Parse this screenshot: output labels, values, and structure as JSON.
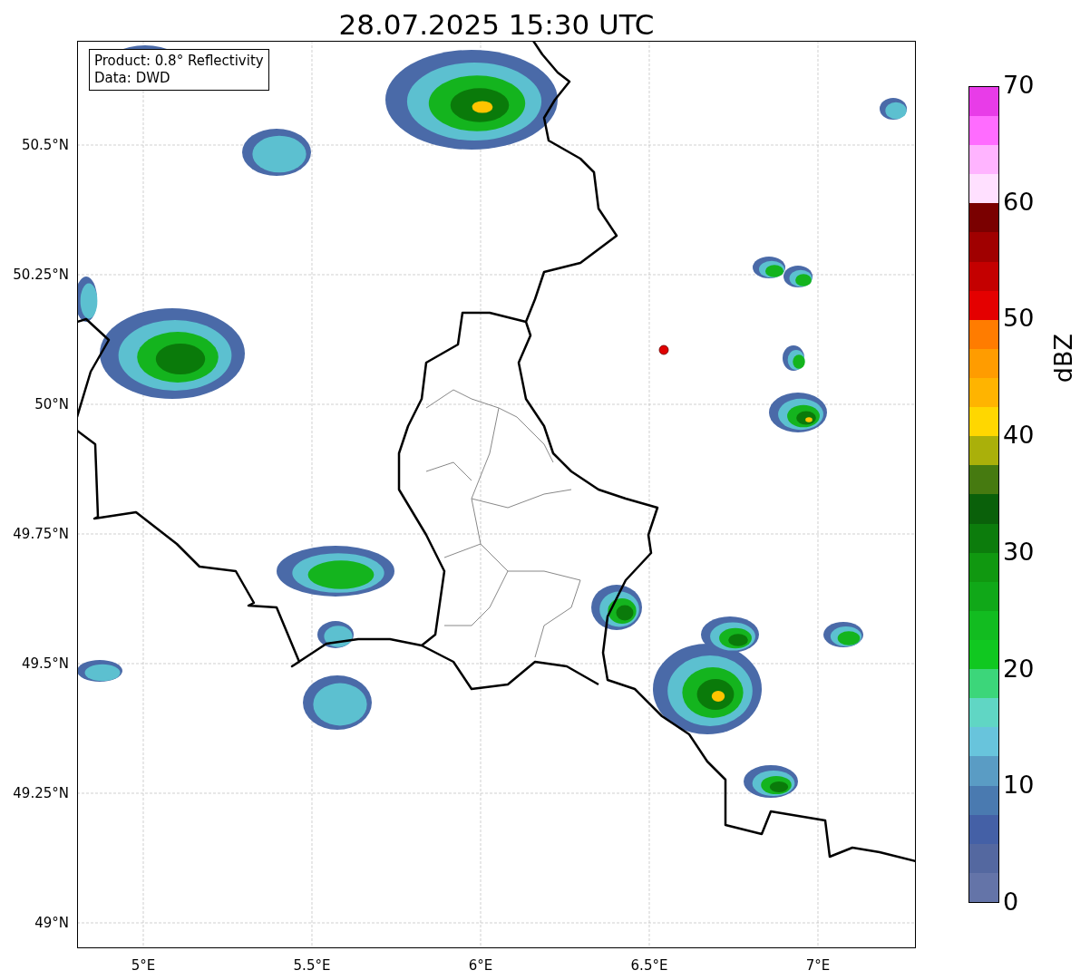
{
  "title": "28.07.2025 15:30 UTC",
  "legend": [
    "Product: 0.8° Reflectivity",
    "Data: DWD"
  ],
  "y_ticks": [
    "50.5°N",
    "50.25°N",
    "50°N",
    "49.75°N",
    "49.5°N",
    "49.25°N",
    "49°N"
  ],
  "x_ticks": [
    "5°E",
    "5.5°E",
    "6°E",
    "6.5°E",
    "7°E"
  ],
  "colorbar": {
    "label": "dBZ",
    "ticks": [
      "70",
      "60",
      "50",
      "40",
      "30",
      "20",
      "10",
      "0"
    ],
    "bands": [
      {
        "color": "#6474a8"
      },
      {
        "color": "#5468a0"
      },
      {
        "color": "#4460a6"
      },
      {
        "color": "#4a7ab0"
      },
      {
        "color": "#5a9cc4"
      },
      {
        "color": "#68c4dc"
      },
      {
        "color": "#60d6c4"
      },
      {
        "color": "#3cd67a"
      },
      {
        "color": "#10c820"
      },
      {
        "color": "#12bc20"
      },
      {
        "color": "#10a818"
      },
      {
        "color": "#109810"
      },
      {
        "color": "#0c7c0c"
      },
      {
        "color": "#0a600a"
      },
      {
        "color": "#467a10"
      },
      {
        "color": "#aab00a"
      },
      {
        "color": "#ffd700"
      },
      {
        "color": "#ffb400"
      },
      {
        "color": "#ff9c00"
      },
      {
        "color": "#ff7c00"
      },
      {
        "color": "#e40000"
      },
      {
        "color": "#c40000"
      },
      {
        "color": "#a00000"
      },
      {
        "color": "#7a0000"
      },
      {
        "color": "#ffe0ff"
      },
      {
        "color": "#ffb4ff"
      },
      {
        "color": "#ff6cff"
      },
      {
        "color": "#e83ce8"
      }
    ]
  }
}
